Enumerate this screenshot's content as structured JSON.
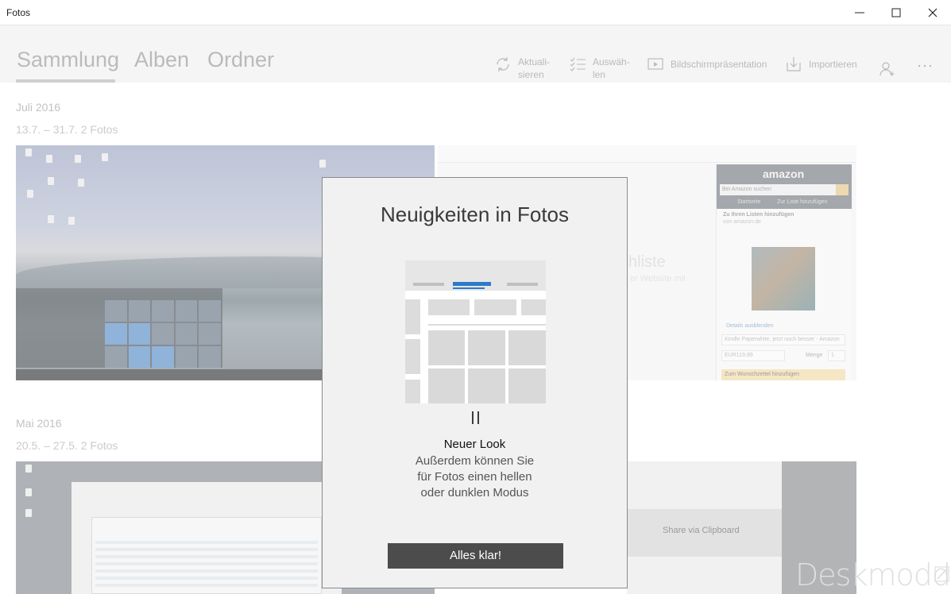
{
  "window": {
    "title": "Fotos"
  },
  "nav": {
    "tabs": [
      {
        "label": "Sammlung"
      },
      {
        "label": "Alben"
      },
      {
        "label": "Ordner"
      }
    ],
    "toolbar": {
      "refresh_line1": "Aktuali-",
      "refresh_line2": "sieren",
      "select_line1": "Auswäh-",
      "select_line2": "len",
      "slideshow": "Bildschirmpräsentation",
      "import": "Importieren"
    }
  },
  "gallery": {
    "groups": [
      {
        "month": "Juli 2016",
        "range": "13.7. – 31.7.   2 Fotos"
      },
      {
        "month": "Mai 2016",
        "range": "20.5. – 27.5.   2 Fotos"
      }
    ],
    "amazon": {
      "logo": "amazon",
      "search_placeholder": "Bei Amazon suchen",
      "tab1": "Startseite",
      "tab2": "Zur Liste hinzufügen",
      "list_heading": "Zu Ihren Listen hinzufügen",
      "source": "von amazon.de",
      "details": "Details ausblenden",
      "product": "Kindle Paperwhite, jetzt noch besser - Amazon",
      "price": "EUR119.99",
      "qty_label": "Menge",
      "qty": "1",
      "add_button": "Zum Wunschzettel hinzufügen",
      "ghost_title": "schliste",
      "ghost_sub": "er Website mit"
    },
    "share": {
      "label": "Share via Clipboard"
    },
    "watermark": "Deskmodder.de"
  },
  "dialog": {
    "title": "Neuigkeiten in Fotos",
    "heading": "Neuer Look",
    "body_line1": "Außerdem können Sie",
    "body_line2": "für Fotos einen hellen",
    "body_line3": "oder dunklen Modus",
    "ok_label": "Alles klar!"
  },
  "colors": {
    "accent": "#2d7bc8",
    "button": "#4c4c4c",
    "dialog_bg": "#f1f1f1"
  }
}
